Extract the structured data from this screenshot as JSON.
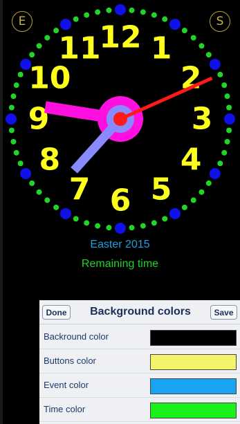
{
  "colors": {
    "background": "#000000",
    "dial_dots": "#22d42a",
    "dial_big_dots": "#1010e8",
    "numerals": "#ffff1e",
    "hour_hand": "#ff10e0",
    "minute_hand": "#8a8aff",
    "second_hand": "#ff1a1a",
    "event_text": "#1f9fe0",
    "remaining_text": "#22d42a"
  },
  "corner_buttons": {
    "left": "E",
    "right": "S"
  },
  "clock": {
    "numerals": [
      "12",
      "1",
      "2",
      "3",
      "4",
      "5",
      "6",
      "7",
      "8",
      "9",
      "10",
      "11"
    ],
    "hour_hand_value": 9.3,
    "minute_hand_value": 37,
    "second_hand_value": 11
  },
  "event": {
    "title": "Easter 2015",
    "remaining_label": "Remaining time"
  },
  "panel": {
    "title": "Background colors",
    "done_label": "Done",
    "save_label": "Save",
    "rows": [
      {
        "label": "Backround color",
        "color": "#000000"
      },
      {
        "label": "Buttons color",
        "color": "#f5f36a"
      },
      {
        "label": "Event color",
        "color": "#1aa3f0"
      },
      {
        "label": "Time color",
        "color": "#1af01a"
      }
    ]
  }
}
